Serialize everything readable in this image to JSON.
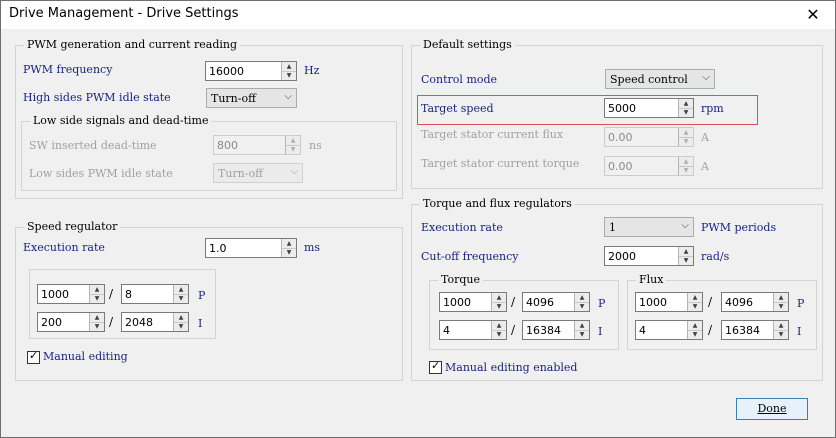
{
  "window": {
    "title": "Drive Management - Drive Settings",
    "close_glyph": "✕"
  },
  "pwm": {
    "title": "PWM generation and current reading",
    "frequency_label": "PWM frequency",
    "frequency_value": "16000",
    "frequency_unit": "Hz",
    "high_idle_label": "High sides PWM idle state",
    "high_idle_value": "Turn-off",
    "low": {
      "title": "Low side signals and dead-time",
      "dead_time_label": "SW inserted dead-time",
      "dead_time_value": "800",
      "dead_time_unit": "ns",
      "low_idle_label": "Low sides PWM idle state",
      "low_idle_value": "Turn-off"
    }
  },
  "speed": {
    "title": "Speed regulator",
    "exec_rate_label": "Execution rate",
    "exec_rate_value": "1.0",
    "exec_rate_unit": "ms",
    "p_num": "1000",
    "p_den": "8",
    "p_label": "P",
    "i_num": "200",
    "i_den": "2048",
    "i_label": "I",
    "manual_label": "Manual editing",
    "manual_checked": true
  },
  "defaults": {
    "title": "Default settings",
    "control_mode_label": "Control mode",
    "control_mode_value": "Speed control",
    "target_speed_label": "Target speed",
    "target_speed_value": "5000",
    "target_speed_unit": "rpm",
    "flux_label": "Target stator current flux",
    "flux_value": "0.00",
    "flux_unit": "A",
    "torque_label": "Target stator current torque",
    "torque_value": "0.00",
    "torque_unit": "A"
  },
  "regulators": {
    "title": "Torque and flux regulators",
    "exec_rate_label": "Execution rate",
    "exec_rate_value": "1",
    "exec_rate_unit": "PWM periods",
    "cutoff_label": "Cut-off frequency",
    "cutoff_value": "2000",
    "cutoff_unit": "rad/s",
    "torque": {
      "title": "Torque",
      "p_num": "1000",
      "p_den": "4096",
      "p_label": "P",
      "i_num": "4",
      "i_den": "16384",
      "i_label": "I"
    },
    "flux": {
      "title": "Flux",
      "p_num": "1000",
      "p_den": "4096",
      "p_label": "P",
      "i_num": "4",
      "i_den": "16384",
      "i_label": "I"
    },
    "manual_label": "Manual editing enabled",
    "manual_checked": true
  },
  "slash": "/",
  "check_glyph": "✓",
  "spin_up": "▲",
  "spin_down": "▼",
  "combo_arrow": "⌵",
  "done_label": "Done"
}
